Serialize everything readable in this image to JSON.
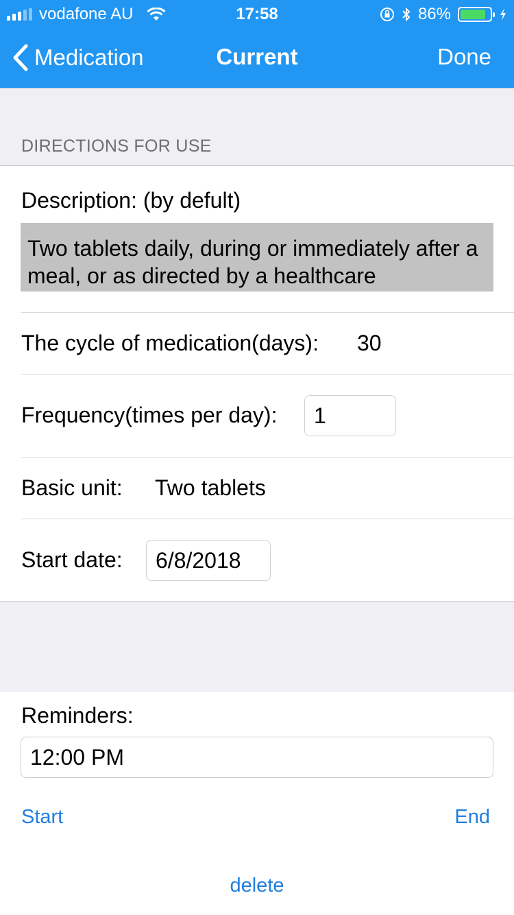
{
  "status_bar": {
    "carrier": "vodafone AU",
    "time": "17:58",
    "battery_percent": "86%",
    "battery_level": 0.86,
    "icons": [
      "signal-icon",
      "wifi-icon",
      "orientation-lock-icon",
      "bluetooth-icon",
      "battery-icon",
      "charging-icon"
    ]
  },
  "nav": {
    "back_label": "Medication",
    "title": "Current",
    "done_label": "Done"
  },
  "colors": {
    "nav_background": "#2196f3",
    "link": "#1f7fe0",
    "grouped_background": "#efeff4",
    "description_background": "#c2c2c2",
    "battery_fill": "#4cd964"
  },
  "section": {
    "header": "DIRECTIONS FOR USE"
  },
  "form": {
    "description_label": "Description: (by defult)",
    "description_text": "Two tablets daily, during or immediately after a meal, or as directed by a healthcare",
    "cycle_label": "The cycle of medication(days):",
    "cycle_value": "30",
    "frequency_label": "Frequency(times per day):",
    "frequency_value": "1",
    "basic_unit_label": "Basic unit:",
    "basic_unit_value": "Two tablets",
    "start_date_label": "Start date:",
    "start_date_value": "6/8/2018"
  },
  "reminders": {
    "label": "Reminders:",
    "time_value": "12:00 PM",
    "start_label": "Start",
    "end_label": "End",
    "delete_label": "delete"
  }
}
